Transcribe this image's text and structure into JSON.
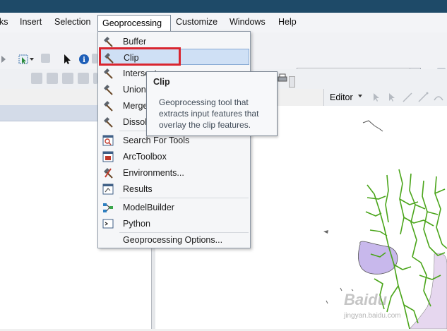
{
  "menubar": {
    "items": [
      "ks",
      "Insert",
      "Selection",
      "Geoprocessing",
      "Customize",
      "Windows",
      "Help"
    ]
  },
  "geoprocessing_menu": {
    "items": [
      {
        "label": "Buffer",
        "icon": "hammer-icon"
      },
      {
        "label": "Clip",
        "icon": "hammer-icon",
        "highlighted": true
      },
      {
        "label": "Intersect",
        "icon": "hammer-icon"
      },
      {
        "label": "Union",
        "icon": "hammer-icon"
      },
      {
        "label": "Merge",
        "icon": "hammer-icon"
      },
      {
        "label": "Dissolve",
        "icon": "hammer-icon"
      },
      {
        "label": "Search For Tools",
        "icon": "search-window-icon"
      },
      {
        "label": "ArcToolbox",
        "icon": "toolbox-icon"
      },
      {
        "label": "Environments...",
        "icon": "environments-icon"
      },
      {
        "label": "Results",
        "icon": "results-icon"
      },
      {
        "label": "ModelBuilder",
        "icon": "modelbuilder-icon"
      },
      {
        "label": "Python",
        "icon": "python-window-icon"
      },
      {
        "label": "Geoprocessing Options...",
        "icon": ""
      }
    ]
  },
  "tooltip": {
    "title": "Clip",
    "text": "Geoprocessing tool that extracts input features that overlay the clip features."
  },
  "editor_toolbar": {
    "label": "Editor"
  },
  "watermark": {
    "text": "Baidu",
    "url": "jingyan.baidu.com"
  },
  "colors": {
    "highlight": "#cfe0f5",
    "red_annotation": "#d9252f",
    "river": "#4aa51a",
    "polygon": "#c8b8ec"
  }
}
